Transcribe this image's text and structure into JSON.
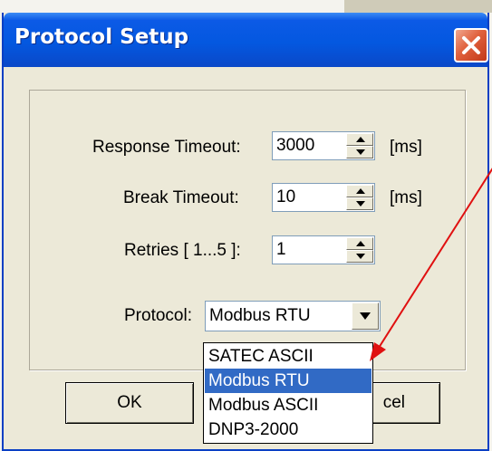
{
  "window": {
    "title": "Protocol Setup",
    "close_icon": "close-icon"
  },
  "fields": {
    "response_timeout": {
      "label": "Response Timeout:",
      "value": "3000",
      "unit": "[ms]"
    },
    "break_timeout": {
      "label": "Break Timeout:",
      "value": "10",
      "unit": "[ms]"
    },
    "retries": {
      "label": "Retries [ 1...5 ]:",
      "value": "1"
    },
    "protocol": {
      "label": "Protocol:",
      "value": "Modbus RTU"
    }
  },
  "dropdown": {
    "options": [
      "SATEC ASCII",
      "Modbus RTU",
      "Modbus ASCII",
      "DNP3-2000"
    ],
    "selected_index": 1
  },
  "buttons": {
    "ok": "OK",
    "cancel": "cel"
  },
  "colors": {
    "title_blue": "#0458e0",
    "selection": "#316ac5",
    "arrow": "#e01010",
    "dialog_bg": "#ece9d8"
  }
}
